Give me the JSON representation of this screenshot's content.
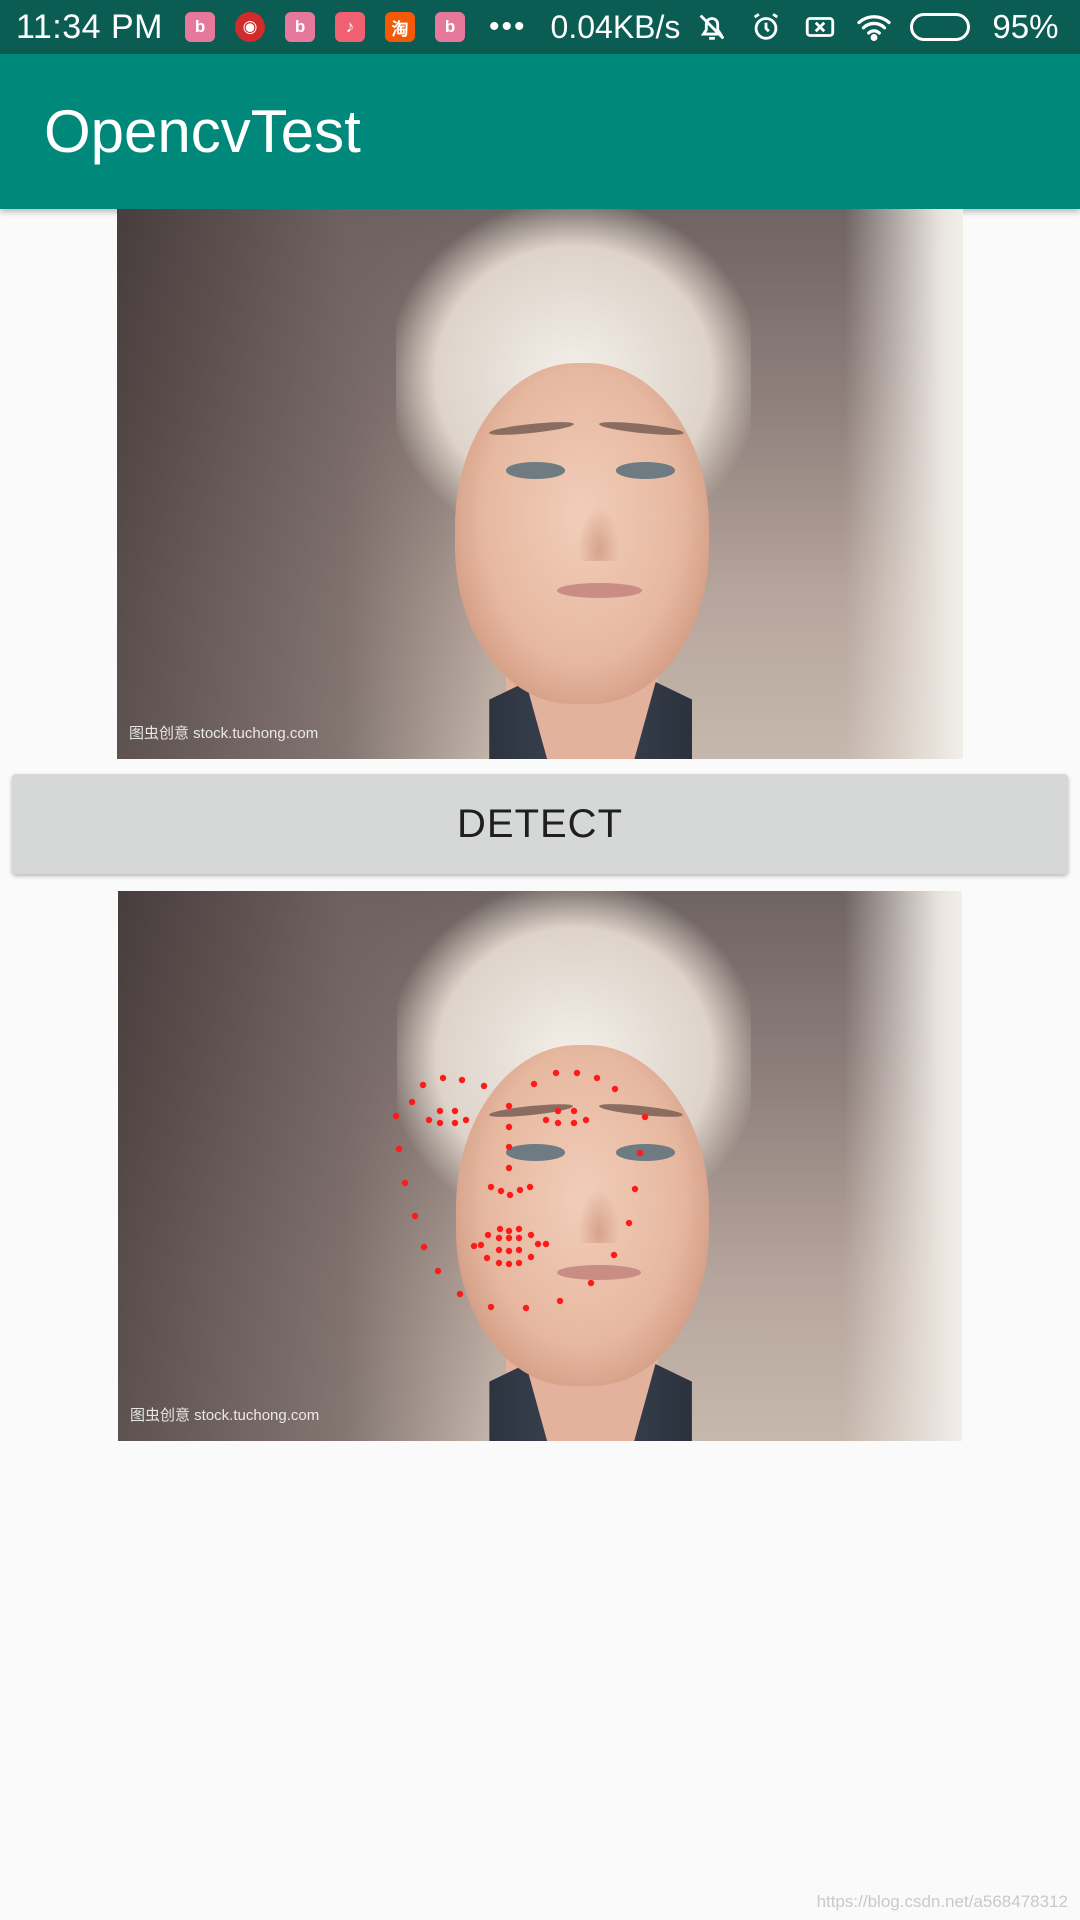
{
  "status_bar": {
    "time": "11:34 PM",
    "notification_icons": [
      {
        "icon": "bilibili-icon",
        "glyph": "b",
        "kind": "bili"
      },
      {
        "icon": "netease-music-icon",
        "glyph": "◉",
        "kind": "music"
      },
      {
        "icon": "bilibili-icon",
        "glyph": "b",
        "kind": "bili"
      },
      {
        "icon": "tiktok-icon",
        "glyph": "♪",
        "kind": "tiktok"
      },
      {
        "icon": "taobao-icon",
        "glyph": "淘",
        "kind": "taobao"
      },
      {
        "icon": "bilibili-icon",
        "glyph": "b",
        "kind": "bili"
      }
    ],
    "more_indicator": "•••",
    "network_speed": "0.04KB/s",
    "battery_percent": "95%",
    "battery_level": 0.95,
    "battery_color": "#f5a623"
  },
  "app_bar": {
    "title": "OpencvTest",
    "color": "#00897b"
  },
  "original_image": {
    "watermark": "图虫创意 stock.tuchong.com"
  },
  "detect_button": {
    "label": "DETECT"
  },
  "result_image": {
    "watermark": "图虫创意 stock.tuchong.com",
    "landmark_color": "#ff1a1a"
  },
  "page_watermark": "https://blog.csdn.net/a568478312"
}
